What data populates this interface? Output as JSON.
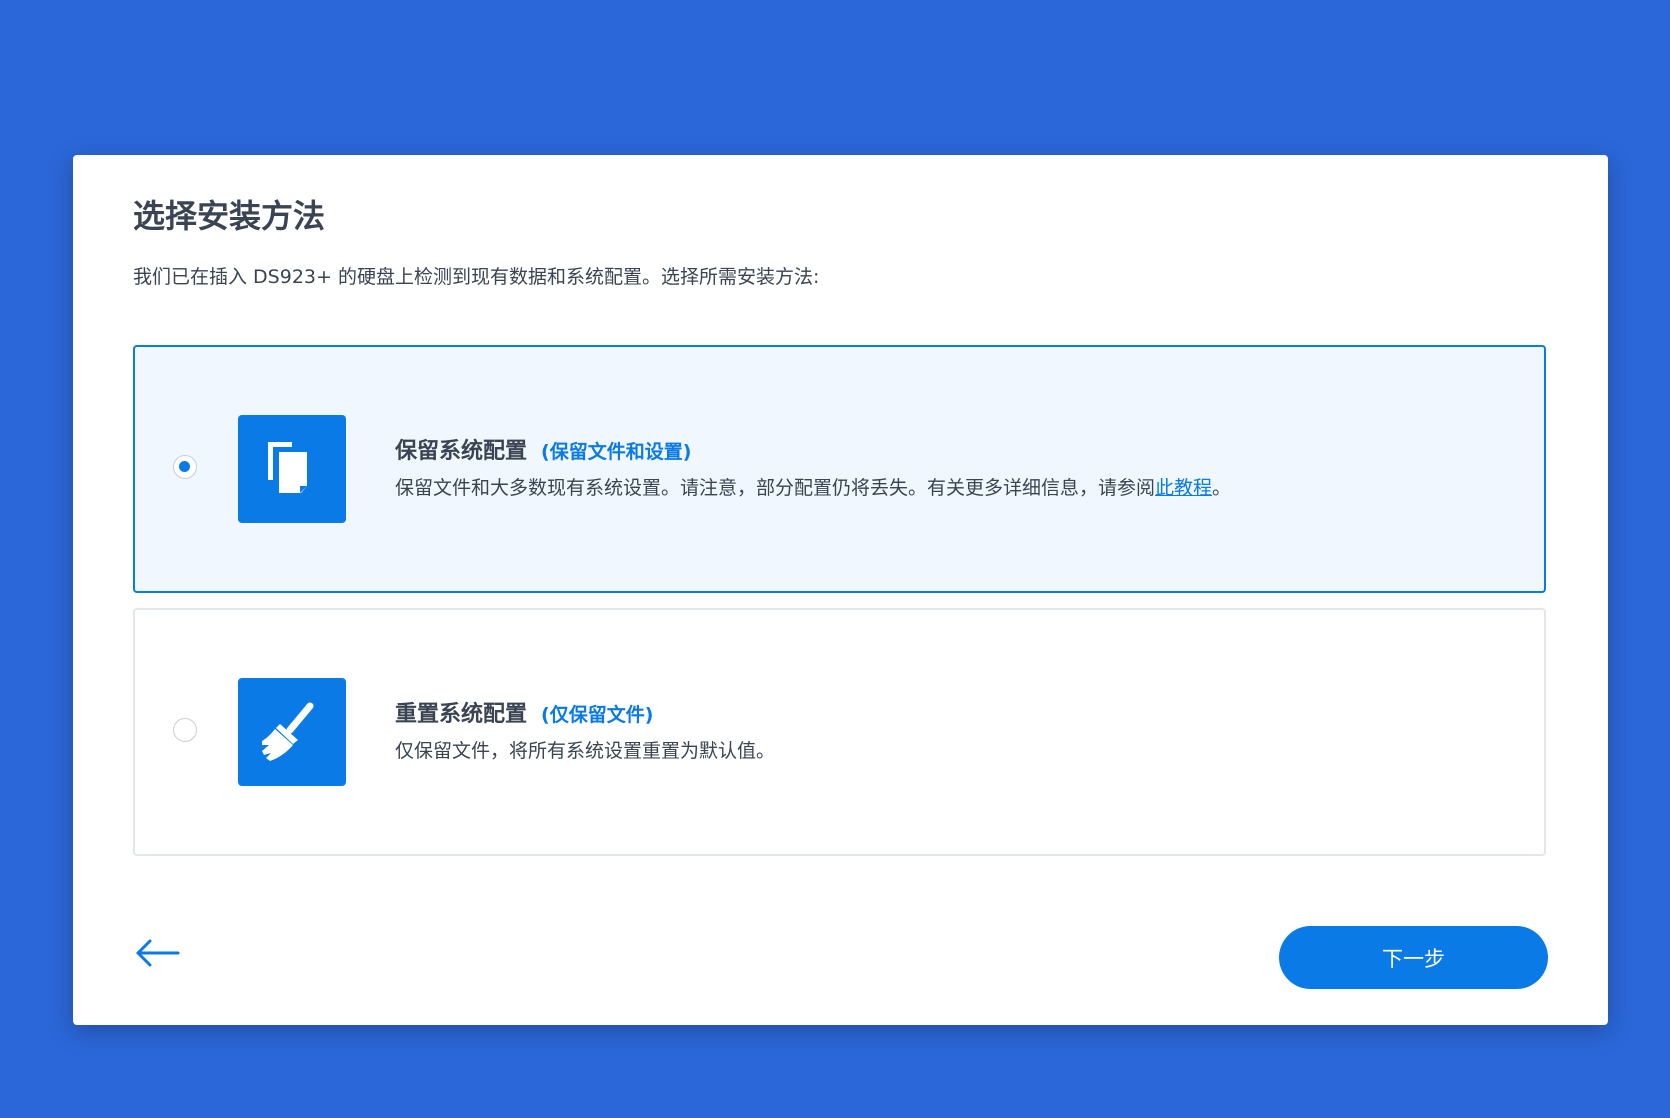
{
  "dialog": {
    "title": "选择安装方法",
    "subtitle": "我们已在插入 DS923+ 的硬盘上检测到现有数据和系统配置。选择所需安装方法:"
  },
  "options": [
    {
      "title": "保留系统配置",
      "tag": "(保留文件和设置)",
      "desc_prefix": "保留文件和大多数现有系统设置。请注意，部分配置仍将丢失。有关更多详细信息，请参阅",
      "link_text": "此教程",
      "desc_suffix": "。",
      "icon": "copy-files-icon",
      "selected": true
    },
    {
      "title": "重置系统配置",
      "tag": "(仅保留文件)",
      "desc": "仅保留文件，将所有系统设置重置为默认值。",
      "icon": "broom-icon",
      "selected": false
    }
  ],
  "footer": {
    "back_icon": "arrow-left-icon",
    "next_label": "下一步"
  },
  "colors": {
    "background": "#2b67d9",
    "accent": "#0a7ae6",
    "text": "#3a4452",
    "selected_bg": "#f0f7fe"
  }
}
